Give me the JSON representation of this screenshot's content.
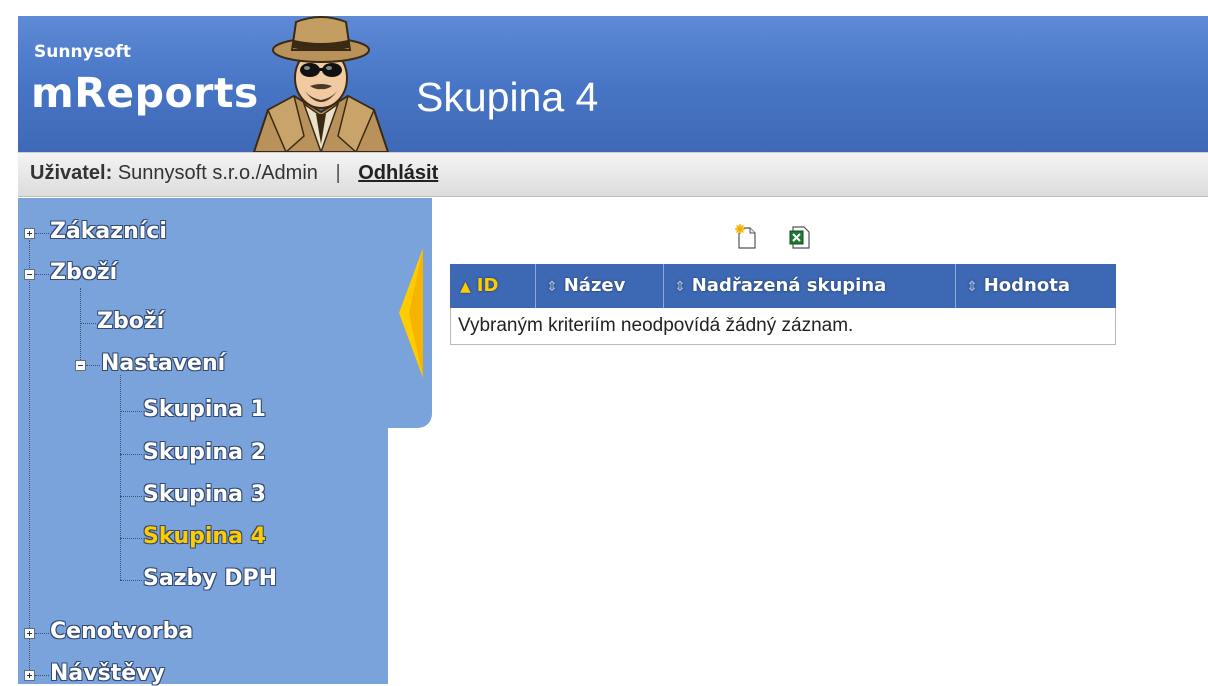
{
  "header": {
    "brand_small": "Sunnysoft",
    "brand_big": "mReports",
    "page_title": "Skupina 4"
  },
  "userbar": {
    "label": "Uživatel:",
    "user": "Sunnysoft s.r.o./Admin",
    "separator": "|",
    "logout": "Odhlásit"
  },
  "sidebar": {
    "items": [
      {
        "label": "Zákazníci",
        "state": "collapsed"
      },
      {
        "label": "Zboží",
        "state": "expanded"
      },
      {
        "label": "Zboží"
      },
      {
        "label": "Nastavení",
        "state": "expanded"
      },
      {
        "label": "Skupina 1"
      },
      {
        "label": "Skupina 2"
      },
      {
        "label": "Skupina 3"
      },
      {
        "label": "Skupina 4",
        "active": true
      },
      {
        "label": "Sazby DPH"
      },
      {
        "label": "Cenotvorba",
        "state": "collapsed"
      },
      {
        "label": "Návštěvy",
        "state": "collapsed"
      }
    ]
  },
  "toolbar": {
    "new_icon": "new-record-icon",
    "excel_icon": "excel-export-icon"
  },
  "grid": {
    "columns": [
      "ID",
      "Název",
      "Nadřazená skupina",
      "Hodnota"
    ],
    "sorted_column": "ID",
    "empty_message": "Vybraným kriteriím neodpovídá žádný záznam."
  },
  "colors": {
    "banner": "#4674c4",
    "sidebar": "#7aa2db",
    "grid_header": "#3d68b3",
    "active": "#ffcc00"
  }
}
